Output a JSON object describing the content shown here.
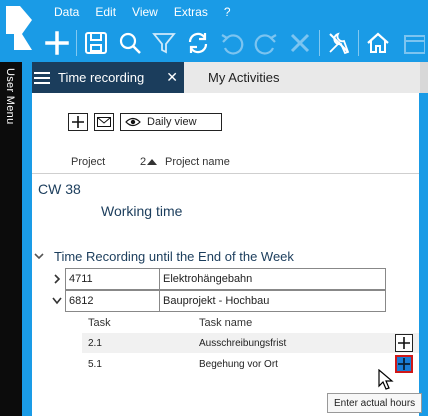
{
  "menu": [
    "Data",
    "Edit",
    "View",
    "Extras",
    "?"
  ],
  "toolbar": {
    "icons": [
      "plus-icon",
      "save-icon",
      "search-icon",
      "filter-icon",
      "refresh-icon",
      "undo-icon",
      "redo-icon",
      "delete-icon",
      "settings-tools-icon",
      "home-icon",
      "calendar-icon"
    ]
  },
  "side": {
    "user_menu": "User Menu"
  },
  "tabs": [
    {
      "label": "Time recording",
      "close": "✕"
    },
    {
      "label": "My Activities"
    }
  ],
  "actions": {
    "view_label": "Daily view"
  },
  "table_header": {
    "project": "Project",
    "sort_index": "2",
    "project_name": "Project name"
  },
  "calendar_week": "CW 38",
  "section_title": "Working time",
  "group": {
    "label": "Time Recording until the End of the Week"
  },
  "projects": [
    {
      "id": "4711",
      "name": "Elektrohängebahn",
      "arrow": ">"
    },
    {
      "id": "6812",
      "name": "Bauprojekt - Hochbau",
      "arrow": "v"
    }
  ],
  "task_header": {
    "task": "Task",
    "task_name": "Task name"
  },
  "tasks": [
    {
      "code": "2.1",
      "name": "Ausschreibungsfrist"
    },
    {
      "code": "5.1",
      "name": "Begehung vor Ort"
    }
  ],
  "tooltip": "Enter actual hours",
  "colors": {
    "brand": "#1a9be6",
    "dark_tab": "#1b3d5c",
    "highlight": "#d01818"
  }
}
